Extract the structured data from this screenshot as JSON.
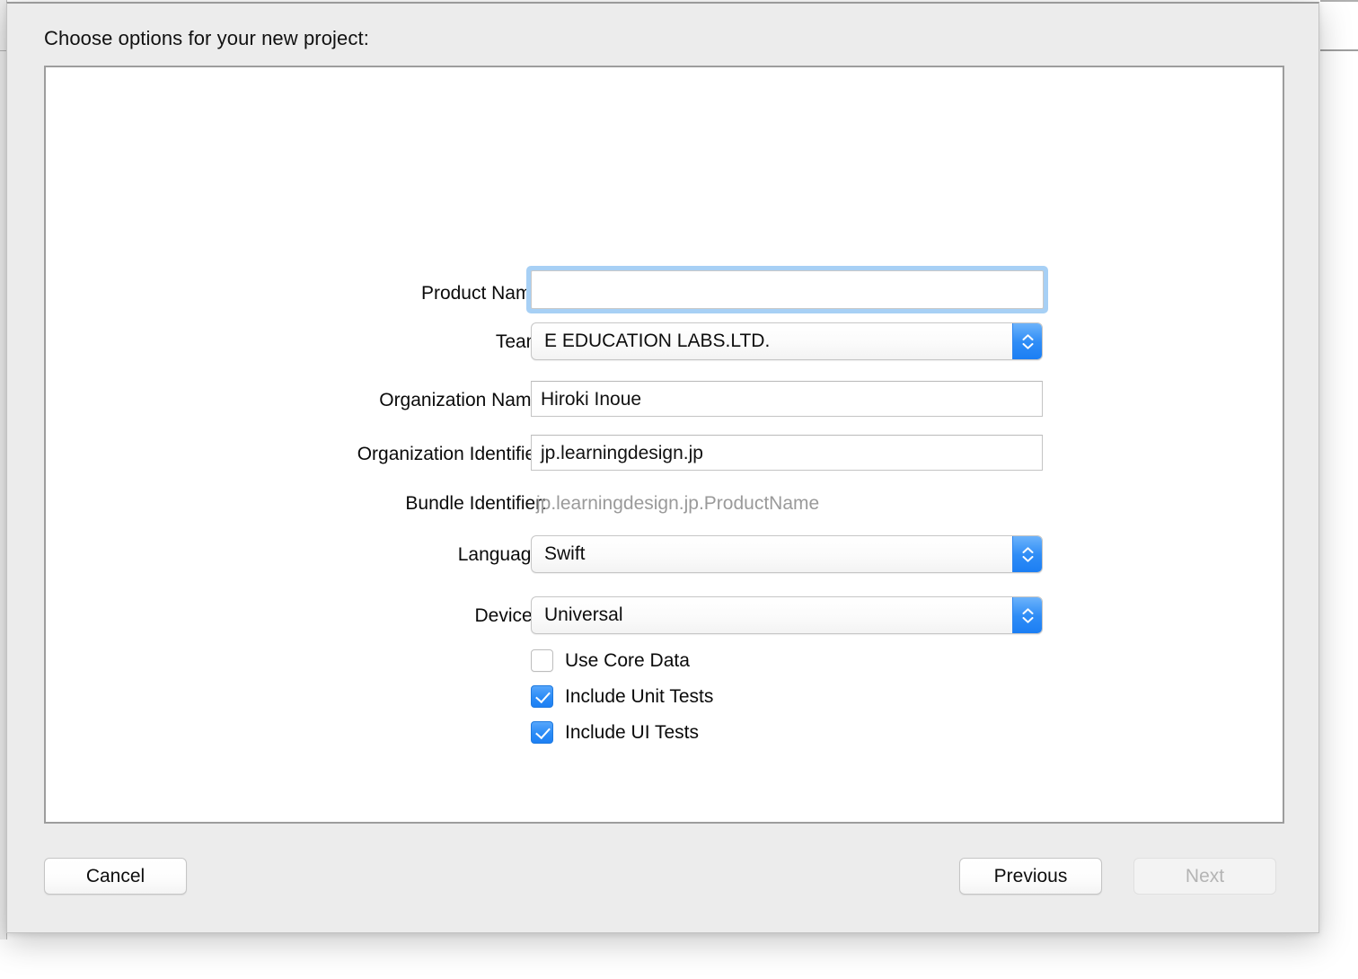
{
  "dialog": {
    "title": "Choose options for your new project:"
  },
  "form": {
    "rows": [
      {
        "label": "Product Name:",
        "type": "textfield",
        "value": "",
        "placeholder": "",
        "focused": true
      },
      {
        "label": "Team:",
        "type": "popup",
        "value": "E EDUCATION LABS.LTD."
      },
      {
        "label": "Organization Name:",
        "type": "textfield",
        "value": "Hiroki Inoue",
        "placeholder": ""
      },
      {
        "label": "Organization Identifier:",
        "type": "textfield",
        "value": "jp.learningdesign.jp",
        "placeholder": ""
      },
      {
        "label": "Bundle Identifier:",
        "type": "static",
        "value": "jp.learningdesign.jp.ProductName"
      },
      {
        "label": "Language:",
        "type": "popup",
        "value": "Swift"
      },
      {
        "label": "Devices:",
        "type": "popup",
        "value": "Universal"
      }
    ],
    "checkboxes": [
      {
        "label": "Use Core Data",
        "checked": false
      },
      {
        "label": "Include Unit Tests",
        "checked": true
      },
      {
        "label": "Include UI Tests",
        "checked": true
      }
    ]
  },
  "footer": {
    "cancel_label": "Cancel",
    "previous_label": "Previous",
    "next_label": "Next",
    "next_enabled": false
  },
  "colors": {
    "accent_blue": "#2b8bf6",
    "focus_ring": "#a7d0f5",
    "sheet_bg": "#ececec",
    "panel_bg": "#ffffff",
    "muted_text": "#9a9a9a"
  }
}
